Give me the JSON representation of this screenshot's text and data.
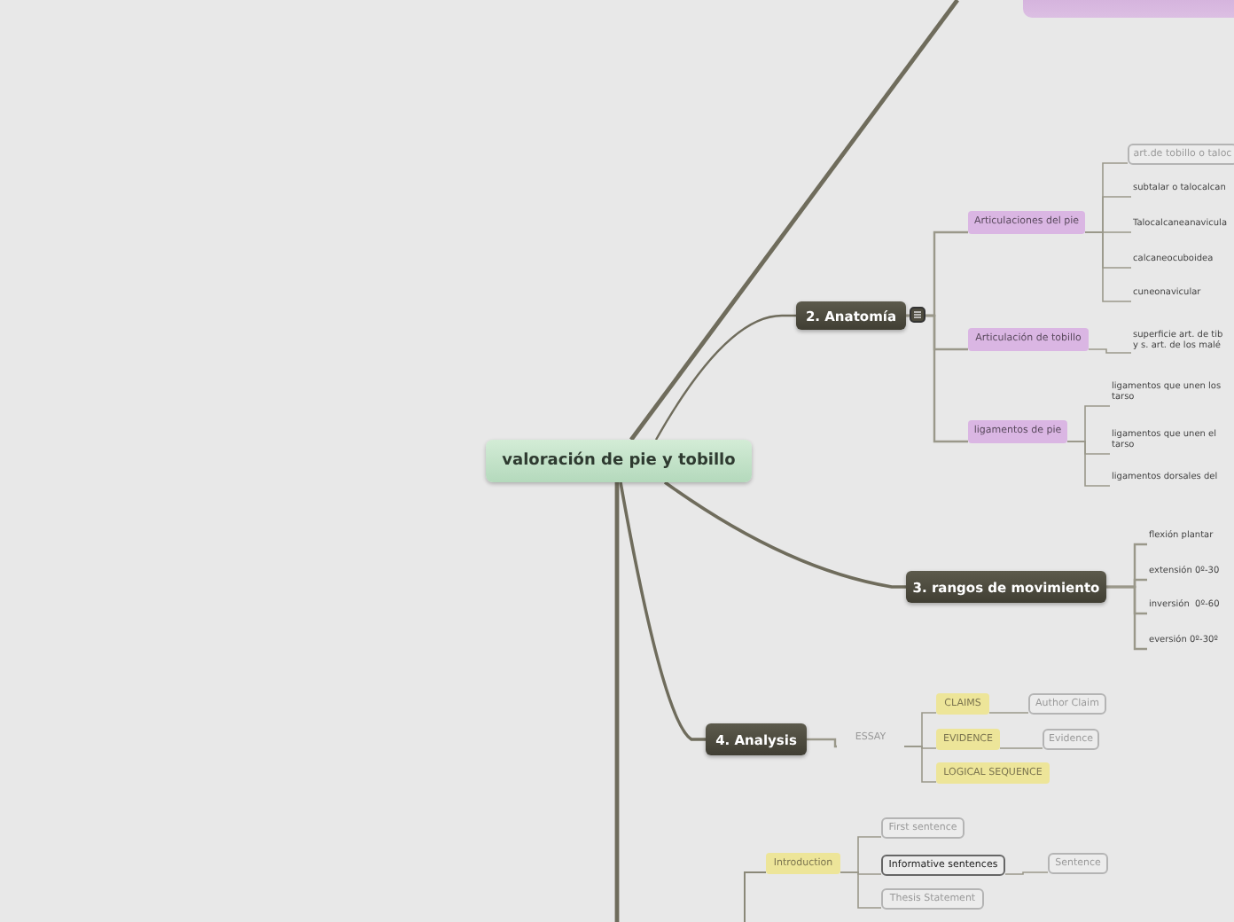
{
  "central_topic": {
    "label": "valoración de pie y tobillo"
  },
  "branches": [
    {
      "label": "2. Anatomía",
      "kind": "main",
      "children": [
        {
          "label": "Articulaciones del pie",
          "kind": "category",
          "children": [
            {
              "label": "art.de tobillo o taloc",
              "kind": "outline"
            },
            {
              "label": "subtalar o talocalcan",
              "kind": "plain"
            },
            {
              "label": "Talocalcaneanavicula",
              "kind": "plain"
            },
            {
              "label": "calcaneocuboidea",
              "kind": "plain"
            },
            {
              "label": "cuneonavicular",
              "kind": "plain"
            }
          ]
        },
        {
          "label": "Articulación de tobillo",
          "kind": "category",
          "children": [
            {
              "label": "superficie art. de tib\ny s. art. de los malé",
              "kind": "plain"
            }
          ]
        },
        {
          "label": "ligamentos de pie",
          "kind": "category",
          "children": [
            {
              "label": "ligamentos que unen los\ntarso",
              "kind": "plain"
            },
            {
              "label": "ligamentos que unen el\ntarso",
              "kind": "plain"
            },
            {
              "label": "ligamentos dorsales del",
              "kind": "plain"
            }
          ]
        }
      ]
    },
    {
      "label": "3. rangos de movimiento",
      "kind": "main",
      "children": [
        {
          "label": "flexión plantar",
          "kind": "plain"
        },
        {
          "label": "extensión 0º-30",
          "kind": "plain"
        },
        {
          "label": "inversión  0º-60",
          "kind": "plain"
        },
        {
          "label": "eversión 0º-30º",
          "kind": "plain"
        }
      ]
    },
    {
      "label": "4. Analysis",
      "kind": "main",
      "children": [
        {
          "label": "ESSAY",
          "kind": "label",
          "children": [
            {
              "label": "CLAIMS",
              "kind": "highlight",
              "children": [
                {
                  "label": "Author Claim",
                  "kind": "outline"
                }
              ]
            },
            {
              "label": "EVIDENCE",
              "kind": "highlight",
              "children": [
                {
                  "label": "Evidence",
                  "kind": "outline"
                }
              ]
            },
            {
              "label": "LOGICAL SEQUENCE",
              "kind": "highlight"
            }
          ]
        }
      ]
    }
  ],
  "lower_branch": {
    "children": [
      {
        "label": "Introduction",
        "kind": "highlight",
        "children": [
          {
            "label": "First sentence",
            "kind": "outline"
          },
          {
            "label": "Informative sentences",
            "kind": "outline-strong",
            "children": [
              {
                "label": "Sentence",
                "kind": "outline"
              }
            ]
          },
          {
            "label": "Thesis Statement",
            "kind": "outline"
          }
        ]
      }
    ]
  }
}
